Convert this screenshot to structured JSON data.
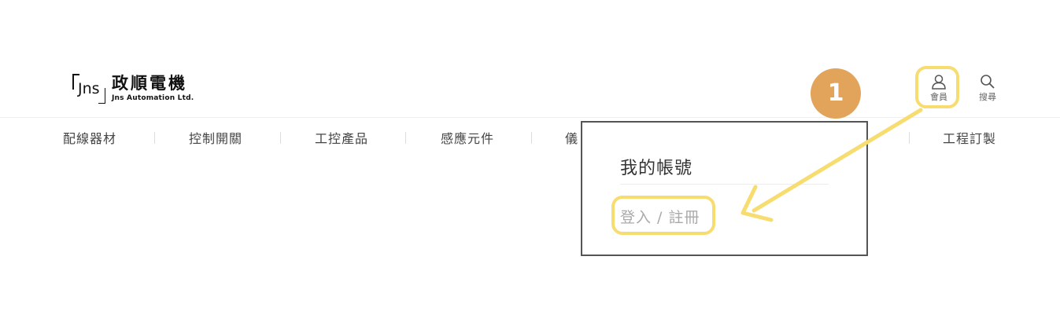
{
  "logo": {
    "mark": "Jns",
    "name_zh": "政順電機",
    "name_en": "Jns Automation Ltd."
  },
  "header": {
    "member": {
      "label": "會員",
      "icon": "user-icon"
    },
    "search": {
      "label": "搜尋",
      "icon": "search-icon"
    }
  },
  "nav": {
    "items": [
      "配線器材",
      "控制開關",
      "工控產品",
      "感應元件",
      "儀",
      "工程訂製"
    ]
  },
  "annotation": {
    "step": "1",
    "highlight_color": "#f7dc6f",
    "badge_color": "#e2a45a"
  },
  "dropdown": {
    "title": "我的帳號",
    "login_register": "登入 / 註冊"
  }
}
